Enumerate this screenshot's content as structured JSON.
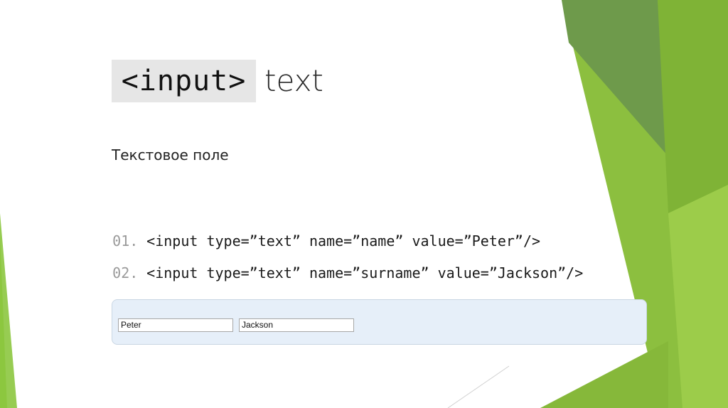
{
  "slide": {
    "title_code": "<input>",
    "title_text": "text",
    "subtitle": "Текстовое поле",
    "code_lines": [
      {
        "num": "01.",
        "code": "<input type=”text” name=”name” value=”Peter”/>"
      },
      {
        "num": "02.",
        "code": "<input type=”text” name=”surname” value=”Jackson”/>"
      }
    ],
    "demo_inputs": [
      "Peter",
      "Jackson"
    ]
  },
  "colors": {
    "accent_green": "#8dc63f",
    "dark_green": "#6e9f3f",
    "demo_bg": "#e6eff9"
  }
}
